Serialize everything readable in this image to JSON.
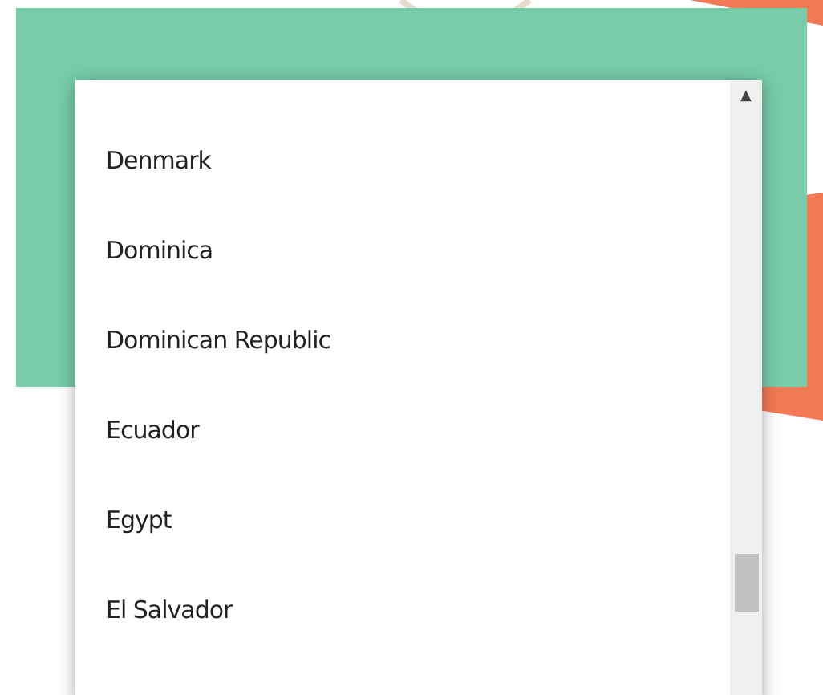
{
  "dropdown": {
    "options": [
      {
        "label": "Denmark"
      },
      {
        "label": "Dominica"
      },
      {
        "label": "Dominican Republic"
      },
      {
        "label": "Ecuador"
      },
      {
        "label": "Egypt"
      },
      {
        "label": "El Salvador"
      }
    ],
    "scroll_up": "▲"
  }
}
